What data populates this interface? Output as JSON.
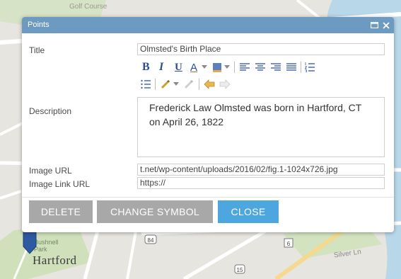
{
  "map": {
    "labels": {
      "golf": "Golf Course",
      "bushnell": "Bushnell Park",
      "hartford": "Hartford",
      "silver": "Silver Ln"
    },
    "shields": [
      "84",
      "6",
      "15"
    ],
    "colors": {
      "land": "#e7e5df",
      "water": "#a9cfe3",
      "park": "#c9dbb4",
      "road": "#ffffff",
      "highway": "#f4d98e"
    }
  },
  "popup": {
    "title": "Points",
    "header_icons": [
      "maximize-icon",
      "close-icon"
    ],
    "header_color": "#6c9ac0",
    "fields": {
      "title_label": "Title",
      "title_value": "Olmsted's Birth Place",
      "description_label": "Description",
      "description_value": "Frederick Law Olmsted was born in Hartford, CT on April 26, 1822",
      "image_url_label": "Image URL",
      "image_url_value": "t.net/wp-content/uploads/2016/02/fig.1-1024x726.jpg",
      "image_link_label": "Image Link URL",
      "image_link_value": "https://"
    },
    "toolbar": {
      "bold": "B",
      "italic": "I",
      "underline": "U",
      "font_color": "A",
      "icons": [
        "bold-icon",
        "italic-icon",
        "underline-icon",
        "font-color-icon",
        "highlight-icon",
        "align-left-icon",
        "align-center-icon",
        "align-right-icon",
        "justify-icon",
        "numbered-list-icon",
        "bullet-list-icon",
        "link-icon",
        "unlink-icon",
        "undo-icon",
        "redo-icon"
      ]
    },
    "buttons": {
      "delete": "DELETE",
      "change_symbol": "CHANGE SYMBOL",
      "close": "CLOSE"
    },
    "button_colors": {
      "gray": "#a8a8a8",
      "blue": "#4ea6df"
    }
  }
}
